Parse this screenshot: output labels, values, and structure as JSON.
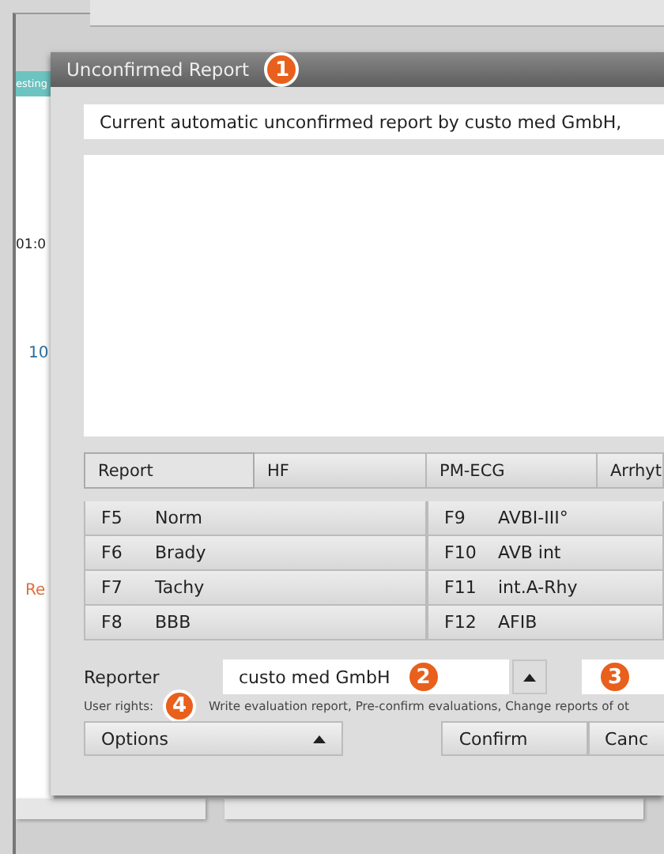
{
  "background": {
    "tab_label": "esting",
    "time": "01:0",
    "value": "10",
    "link": "Re"
  },
  "dialog": {
    "title": "Unconfirmed Report",
    "badge": "1"
  },
  "summary_field": {
    "value": "Current automatic unconfirmed report by custo med GmbH,"
  },
  "tabs": [
    {
      "label": "Report",
      "selected": true
    },
    {
      "label": "HF",
      "selected": false
    },
    {
      "label": "PM-ECG",
      "selected": false
    },
    {
      "label": "Arrhyt",
      "selected": false
    }
  ],
  "findings": [
    {
      "key": "F5",
      "label": "Norm"
    },
    {
      "key": "F6",
      "label": "Brady"
    },
    {
      "key": "F7",
      "label": "Tachy"
    },
    {
      "key": "F8",
      "label": "BBB"
    },
    {
      "key": "F9",
      "label": "AVBI-III°"
    },
    {
      "key": "F10",
      "label": "AVB int"
    },
    {
      "key": "F11",
      "label": "int.A-Rhy"
    },
    {
      "key": "F12",
      "label": "AFIB"
    }
  ],
  "reporter": {
    "label": "Reporter",
    "value": "custo med GmbH",
    "badge": "2",
    "second_badge": "3"
  },
  "user_rights": {
    "label": "User rights:",
    "badge": "4",
    "value": "Write evaluation report, Pre-confirm evaluations, Change reports of ot"
  },
  "buttons": {
    "options": "Options",
    "confirm": "Confirm",
    "cancel": "Canc"
  }
}
